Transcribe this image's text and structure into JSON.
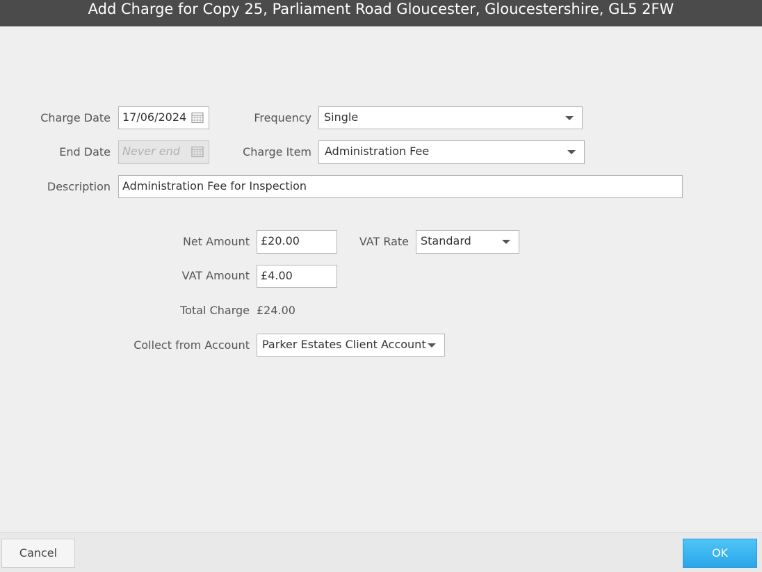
{
  "dialog": {
    "title": "Add Charge for Copy 25, Parliament Road Gloucester, Gloucestershire, GL5 2FW"
  },
  "form": {
    "charge_date": {
      "label": "Charge Date",
      "value": "17/06/2024"
    },
    "end_date": {
      "label": "End Date",
      "placeholder": "Never end",
      "value": ""
    },
    "frequency": {
      "label": "Frequency",
      "value": "Single"
    },
    "charge_item": {
      "label": "Charge Item",
      "value": "Administration Fee"
    },
    "description": {
      "label": "Description",
      "value": "Administration Fee for Inspection"
    },
    "net_amount": {
      "label": "Net Amount",
      "value": "£20.00"
    },
    "vat_rate": {
      "label": "VAT Rate",
      "value": "Standard"
    },
    "vat_amount": {
      "label": "VAT Amount",
      "value": "£4.00"
    },
    "total_charge": {
      "label": "Total Charge",
      "value": "£24.00"
    },
    "collect_from_account": {
      "label": "Collect from Account",
      "value": "Parker Estates Client Account"
    }
  },
  "footer": {
    "cancel_label": "Cancel",
    "ok_label": "OK"
  },
  "colors": {
    "titlebar_bg": "#4b4b4b",
    "page_bg": "#efefef",
    "ok_button": "#2aa6ea"
  },
  "icons": {
    "charge_date_picker": "calendar-icon",
    "end_date_picker": "calendar-icon",
    "dropdown": "chevron-down-icon"
  }
}
